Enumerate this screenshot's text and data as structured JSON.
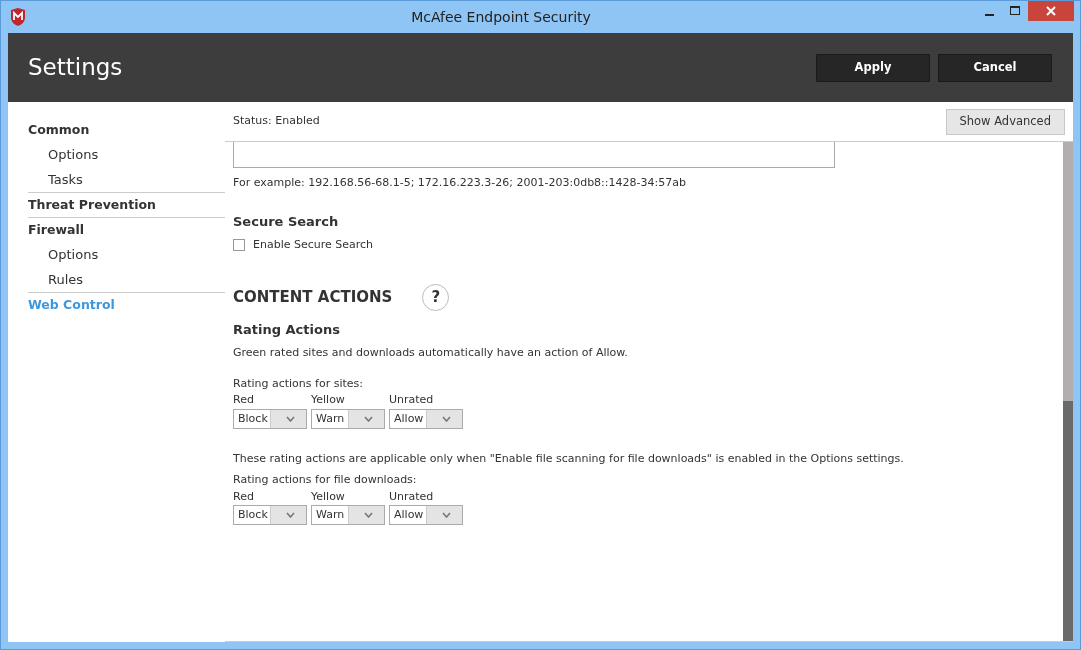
{
  "window": {
    "title": "McAfee Endpoint Security"
  },
  "header": {
    "title": "Settings",
    "buttons": [
      "Apply",
      "Cancel"
    ]
  },
  "sidebar": {
    "items": [
      {
        "label": "Common",
        "selected": false,
        "children": [
          {
            "label": "Options",
            "selected": false
          },
          {
            "label": "Tasks",
            "selected": false
          }
        ]
      },
      {
        "label": "Threat Prevention",
        "selected": false
      },
      {
        "label": "Firewall",
        "selected": false,
        "children": [
          {
            "label": "Options",
            "selected": false
          },
          {
            "label": "Rules",
            "selected": false
          }
        ]
      },
      {
        "label": "Web Control",
        "selected": true
      }
    ]
  },
  "status": "Status: Enabled",
  "advanced_button": "Show Advanced",
  "example": "For example: 192.168.56-68.1-5; 172.16.223.3-26; 2001-203:0db8::1428-34:57ab",
  "secure_search": {
    "heading": "Secure Search",
    "checkbox": {
      "label": "Enable Secure Search",
      "checked": false
    }
  },
  "content_actions": {
    "heading": "CONTENT ACTIONS",
    "help": "?",
    "subheading": "Rating Actions",
    "note": "Green rated sites and downloads automatically have an action of Allow.",
    "groups": [
      {
        "label": "Rating actions for sites:",
        "selects": [
          {
            "label": "Red",
            "value": "Block"
          },
          {
            "label": "Yellow",
            "value": "Warn"
          },
          {
            "label": "Unrated",
            "value": "Allow"
          }
        ]
      },
      {
        "intro": "These rating actions are applicable only when \"Enable file scanning for file downloads\" is enabled in the Options settings.",
        "label": "Rating actions for file downloads:",
        "selects": [
          {
            "label": "Red",
            "value": "Block"
          },
          {
            "label": "Yellow",
            "value": "Warn"
          },
          {
            "label": "Unrated",
            "value": "Allow"
          }
        ]
      }
    ]
  }
}
